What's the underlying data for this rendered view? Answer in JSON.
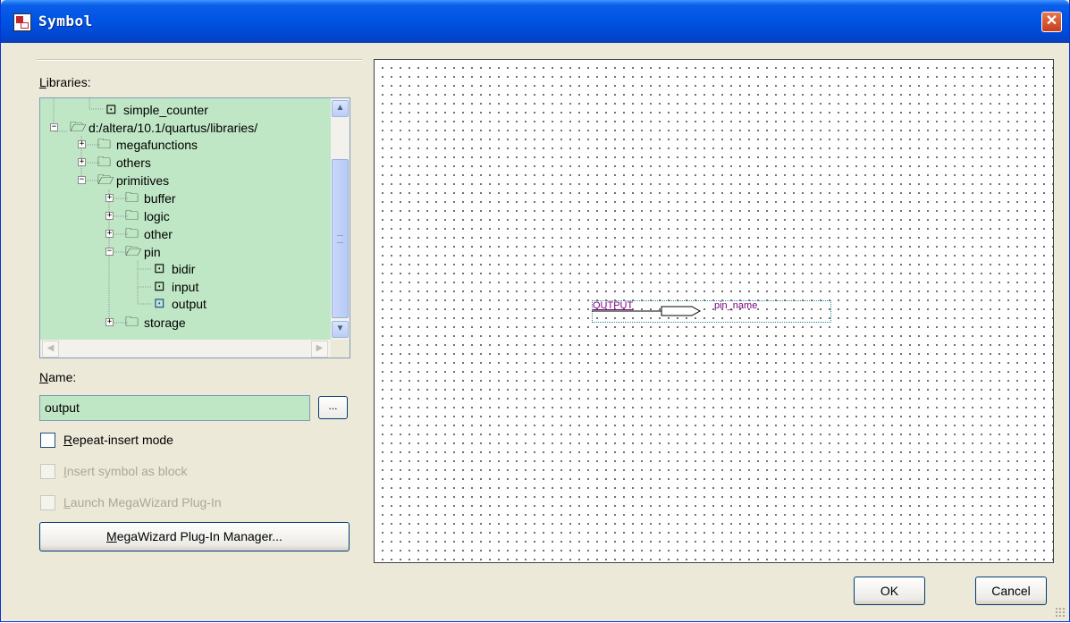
{
  "window": {
    "title": "Symbol",
    "close_glyph": "✕"
  },
  "libraries": {
    "label_prefix": "",
    "label_mnemonic": "L",
    "label_rest": "ibraries:",
    "tree": [
      {
        "label": "simple_counter",
        "icon": "symbol-icon",
        "glyph": "⊡"
      },
      {
        "label": "d:/altera/10.1/quartus/libraries/",
        "icon": "folder-open-icon",
        "glyph": "🗁",
        "expander": "−"
      },
      {
        "label": "megafunctions",
        "icon": "folder-icon",
        "glyph": "🗀",
        "expander": "+"
      },
      {
        "label": "others",
        "icon": "folder-icon",
        "glyph": "🗀",
        "expander": "+"
      },
      {
        "label": "primitives",
        "icon": "folder-open-icon",
        "glyph": "🗁",
        "expander": "−"
      },
      {
        "label": "buffer",
        "icon": "folder-icon",
        "glyph": "🗀",
        "expander": "+"
      },
      {
        "label": "logic",
        "icon": "folder-icon",
        "glyph": "🗀",
        "expander": "+"
      },
      {
        "label": "other",
        "icon": "folder-icon",
        "glyph": "🗀",
        "expander": "+"
      },
      {
        "label": "pin",
        "icon": "folder-open-icon",
        "glyph": "🗁",
        "expander": "−"
      },
      {
        "label": "bidir",
        "icon": "symbol-icon",
        "glyph": "⊡"
      },
      {
        "label": "input",
        "icon": "symbol-icon",
        "glyph": "⊡"
      },
      {
        "label": "output",
        "icon": "symbol-icon",
        "glyph": "⊡",
        "selected": true
      },
      {
        "label": "storage",
        "icon": "folder-icon",
        "glyph": "🗀",
        "expander": "+"
      }
    ],
    "scroll_up": "▲",
    "scroll_down": "▼",
    "scroll_left": "◀",
    "scroll_right": "▶"
  },
  "name": {
    "label_mnemonic": "N",
    "label_rest": "ame:",
    "value": "output",
    "browse_label": "..."
  },
  "options": {
    "repeat_insert": {
      "mnemonic": "R",
      "rest": "epeat-insert mode",
      "checked": false,
      "enabled": true
    },
    "insert_block": {
      "mnemonic": "I",
      "rest": "nsert symbol as block",
      "checked": false,
      "enabled": false
    },
    "launch_wizard": {
      "mnemonic": "L",
      "rest": "aunch MegaWizard Plug-In",
      "checked": false,
      "enabled": false
    }
  },
  "wizard_button": {
    "mnemonic": "M",
    "rest": "egaWizard Plug-In Manager..."
  },
  "preview": {
    "symbol_type": "OUTPUT",
    "pin_name": "pin_name"
  },
  "buttons": {
    "ok": "OK",
    "cancel": "Cancel"
  },
  "colors": {
    "title_bar": "#0054e3",
    "tree_bg": "#bfe7c5",
    "symbol_text": "#800080",
    "symbol_border": "#2a8a8a"
  }
}
